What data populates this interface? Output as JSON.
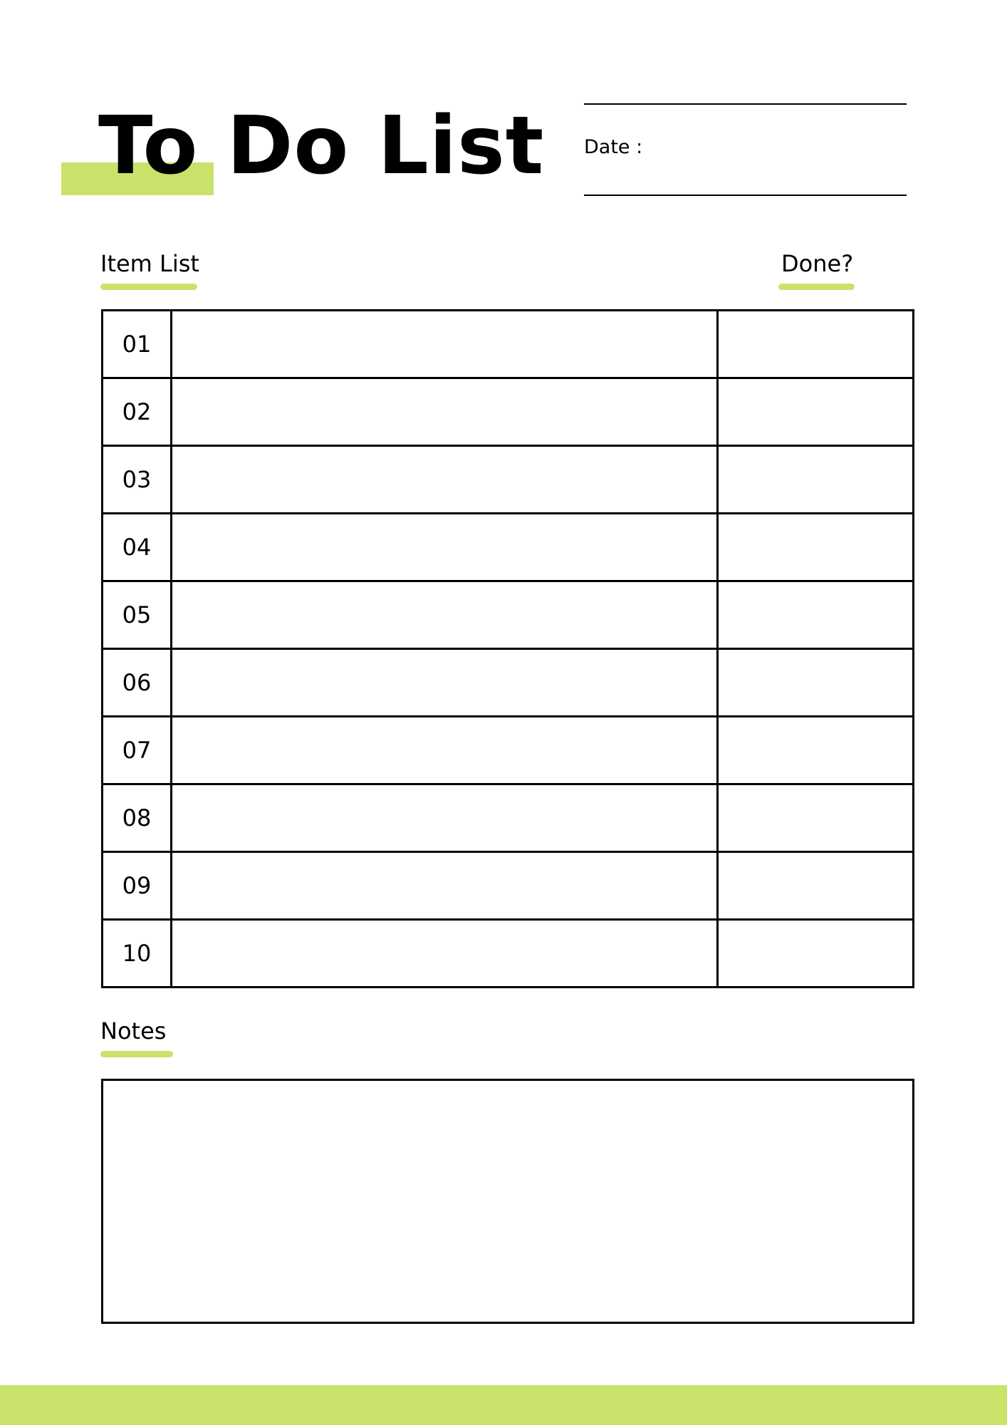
{
  "header": {
    "title": "To Do List",
    "date_label": "Date :"
  },
  "sections": {
    "item_list_label": "Item List",
    "done_label": "Done?",
    "notes_label": "Notes"
  },
  "rows": [
    {
      "number": "01",
      "item": "",
      "done": ""
    },
    {
      "number": "02",
      "item": "",
      "done": ""
    },
    {
      "number": "03",
      "item": "",
      "done": ""
    },
    {
      "number": "04",
      "item": "",
      "done": ""
    },
    {
      "number": "05",
      "item": "",
      "done": ""
    },
    {
      "number": "06",
      "item": "",
      "done": ""
    },
    {
      "number": "07",
      "item": "",
      "done": ""
    },
    {
      "number": "08",
      "item": "",
      "done": ""
    },
    {
      "number": "09",
      "item": "",
      "done": ""
    },
    {
      "number": "10",
      "item": "",
      "done": ""
    }
  ],
  "notes": "",
  "colors": {
    "accent": "#c9e36a",
    "text": "#000000",
    "background": "#ffffff"
  }
}
